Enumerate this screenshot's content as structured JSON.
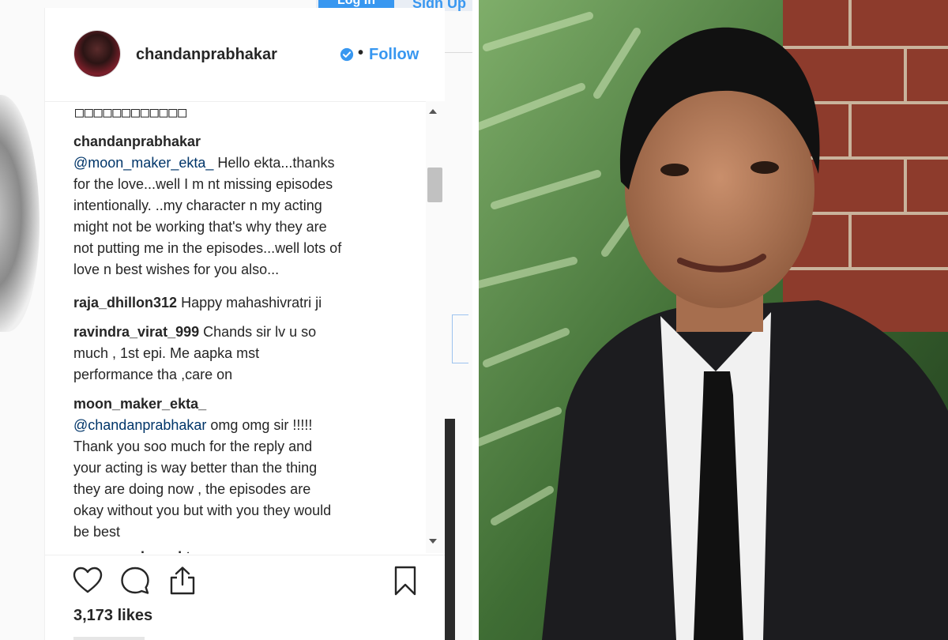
{
  "background_page": {
    "login_label": "Log In",
    "signup_label": "Sign Up"
  },
  "post": {
    "username": "chandanprabhakar",
    "follow_label": "Follow",
    "separator": "•",
    "caption_placeholder": "□□□□□□□□□□□□",
    "comments": [
      {
        "user": "chandanprabhakar",
        "mention": "@moon_maker_ekta_",
        "lines": [
          " Hello ekta...thanks",
          "for the love...well I m nt missing episodes",
          "intentionally. ..my character n my acting",
          "might not be working that's why they are",
          "not putting me in the episodes...well lots of",
          "love n best wishes for you also..."
        ]
      },
      {
        "user": "raja_dhillon312",
        "text": " Happy mahashivratri ji"
      },
      {
        "user": "ravindra_virat_999",
        "lines": [
          " Chands sir lv u so",
          "much , 1st epi. Me aapka mst",
          "performance tha ,care on"
        ]
      },
      {
        "user": "moon_maker_ekta_",
        "mention": "@chandanprabhakar",
        "lines": [
          " omg omg sir !!!!!",
          "Thank you soo much for the reply and",
          "your acting is way better than the thing",
          "they are doing now , the episodes are",
          "okay without you but with you they would",
          "be best"
        ]
      },
      {
        "user": "moon_maker_ekta_"
      }
    ],
    "likes": "3,173 likes"
  },
  "icons": {
    "like": "heart-icon",
    "comment": "comment-icon",
    "share": "share-icon",
    "save": "bookmark-icon",
    "verified": "verified-badge-icon"
  },
  "colors": {
    "link_blue": "#3897f0",
    "text": "#262626",
    "mention": "#003569"
  }
}
